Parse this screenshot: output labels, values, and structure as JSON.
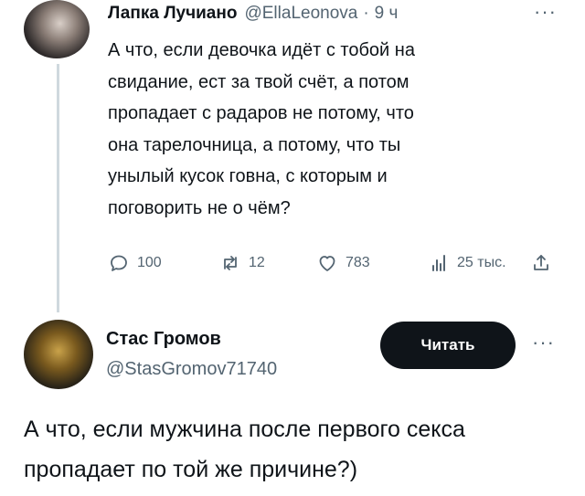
{
  "tweet": {
    "author_name": "Лапка Лучиано",
    "author_handle": "@EllaLeonova",
    "separator": "·",
    "time": "9 ч",
    "more": "···",
    "text_lines": [
      "А что, если девочка идёт с тобой на",
      "свидание, ест за твой счёт, а потом",
      "пропадает с радаров не потому, что",
      "она тарелочница, а потому, что ты",
      "унылый кусок говна, с которым и",
      "поговорить не о чём?"
    ],
    "actions": {
      "replies": "100",
      "retweets": "12",
      "likes": "783",
      "views": "25 тыс."
    },
    "icons": {
      "reply": "reply-icon",
      "retweet": "retweet-icon",
      "like": "heart-icon",
      "views": "views-icon",
      "share": "share-icon"
    }
  },
  "reply": {
    "author_name": "Стас Громов",
    "author_handle": "@StasGromov71740",
    "follow_label": "Читать",
    "more": "···",
    "text_lines": [
      "А что, если мужчина после первого секса",
      "пропадает по той же причине?)"
    ]
  },
  "colors": {
    "text": "#0f1419",
    "secondary": "#536471",
    "thread_line": "#cfd9de",
    "button_bg": "#0f1419",
    "button_text": "#ffffff"
  }
}
